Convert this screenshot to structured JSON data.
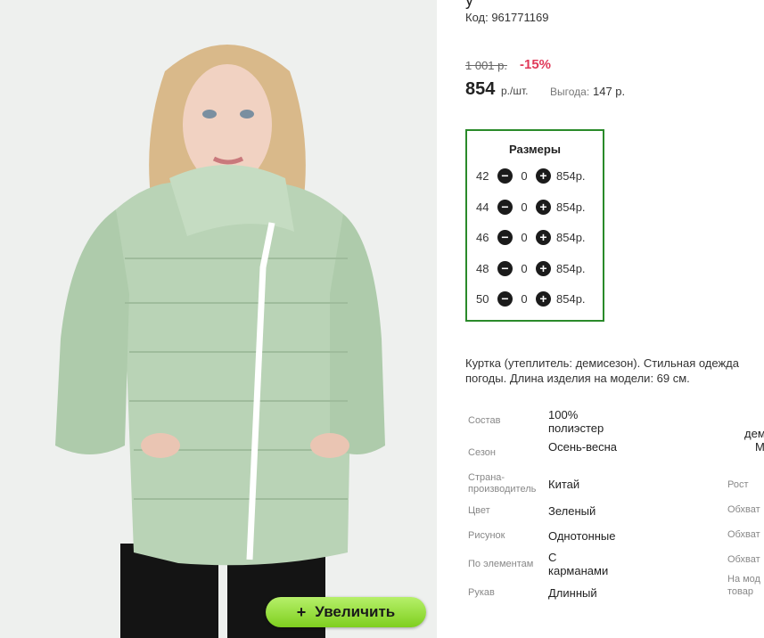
{
  "image": {
    "alt_icon": "jacket-photo"
  },
  "zoom_button": {
    "icon": "+",
    "label": "Увеличить"
  },
  "product": {
    "title_partial": "у",
    "code": "Код: 961771169",
    "old_price": "1 001 р.",
    "discount": "-15%",
    "price": "854",
    "unit": "р./шт.",
    "benefit_label": "Выгода:",
    "benefit_value": "147 р.",
    "sizes_title": "Размеры",
    "sizes": [
      {
        "size": "42",
        "qty": "0",
        "price": "854р."
      },
      {
        "size": "44",
        "qty": "0",
        "price": "854р."
      },
      {
        "size": "46",
        "qty": "0",
        "price": "854р."
      },
      {
        "size": "48",
        "qty": "0",
        "price": "854р."
      },
      {
        "size": "50",
        "qty": "0",
        "price": "854р."
      }
    ],
    "description_line1": "Куртка (утеплитель: демисезон). Стильная одежда",
    "description_line2": "погоды. Длина изделия на модели: 69 см.",
    "props": [
      {
        "label": "Состав",
        "value": "100% полиэстер"
      },
      {
        "label": "Сезон",
        "value": "Осень-весна"
      },
      {
        "label": "Страна-производитель",
        "value": "Китай"
      },
      {
        "label": "Цвет",
        "value": "Зеленый"
      },
      {
        "label": "Рисунок",
        "value": "Однотонные"
      },
      {
        "label": "По элементам",
        "value": "С карманами"
      },
      {
        "label": "Рукав",
        "value": "Длинный"
      }
    ],
    "props2": {
      "top_value_1": "дем",
      "top_value_2": "М",
      "labels": [
        "Рост",
        "Обхват",
        "Обхват",
        "Обхват",
        "На мод",
        "товар"
      ]
    }
  },
  "colors": {
    "accent_green": "#2a8a2a",
    "discount_red": "#e03a5a",
    "button_green": "#7fcf1f"
  }
}
